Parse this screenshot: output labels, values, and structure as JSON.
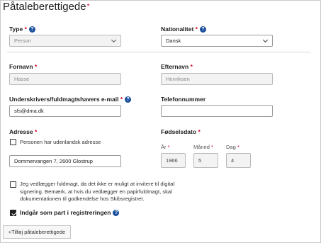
{
  "page": {
    "title": "Påtaleberettigede",
    "required_mark": "*"
  },
  "fields": {
    "type": {
      "label": "Type",
      "value": "Person"
    },
    "nationalitet": {
      "label": "Nationalitet",
      "value": "Dansk"
    },
    "fornavn": {
      "label": "Fornavn",
      "value": "Hasse"
    },
    "efternavn": {
      "label": "Efternavn",
      "value": "Henriksen"
    },
    "email": {
      "label": "Underskrivers/fuldmagtshavers e-mail",
      "value": "sfs@dma.dk"
    },
    "telefon": {
      "label": "Telefonnummer",
      "value": ""
    },
    "adresse": {
      "label": "Adresse",
      "foreign_checkbox_label": "Personen har udenlandsk adresse",
      "foreign_checked": false,
      "value": "Dommervangen 7, 2600 Glostrup"
    },
    "foedselsdato": {
      "label": "Fødselsdato",
      "year_label": "År",
      "month_label": "Måned",
      "day_label": "Dag",
      "year": "1966",
      "month": "5",
      "day": "4"
    }
  },
  "fuldmagt": {
    "checked": false,
    "text": "Jeg vedlægger fuldmagt, da det ikke er muligt at invitere til digital signering. Bemærk, at hvis du vedlægger en papirfuldmagt, skal dokumentationen til godkendelse hos Skibsregistret."
  },
  "part": {
    "checked": true,
    "label": "Indgår som part i registreringen"
  },
  "actions": {
    "add_label": "+Tilføj påtaleberettigede"
  },
  "icons": {
    "help": "help-icon",
    "chevron": "chevron-down-icon",
    "check": "checkmark-icon"
  },
  "colors": {
    "required": "#d4002a",
    "help_icon": "#1a4f9c"
  }
}
